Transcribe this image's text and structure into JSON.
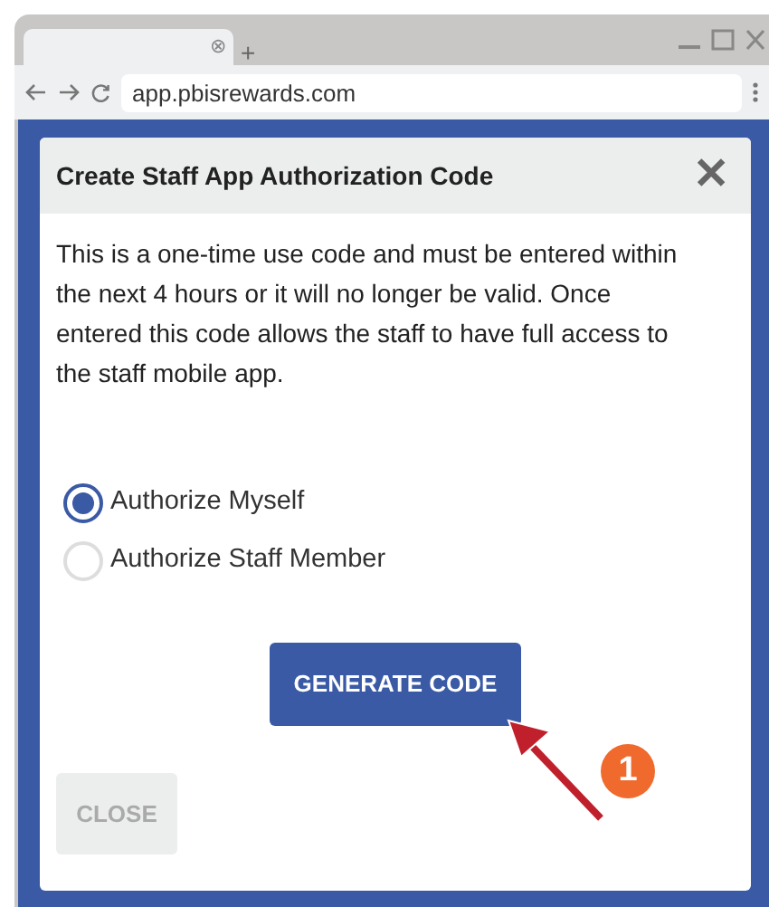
{
  "browser": {
    "url": "app.pbisrewards.com",
    "tab_close": "⊗",
    "new_tab": "+"
  },
  "dialog": {
    "title": "Create Staff App Authorization Code",
    "close_glyph": "✕",
    "message": "This is a one-time use code and must be entered within the next 4 hours or it will no longer be valid. Once entered this code allows the staff to have full access to the staff mobile app.",
    "options": [
      {
        "label": "Authorize Myself",
        "selected": true
      },
      {
        "label": "Authorize Staff Member",
        "selected": false
      }
    ],
    "primary_button": "GENERATE CODE",
    "close_button": {
      "label": "CLOSE",
      "disabled": true
    }
  },
  "annotation": {
    "step": "1"
  }
}
